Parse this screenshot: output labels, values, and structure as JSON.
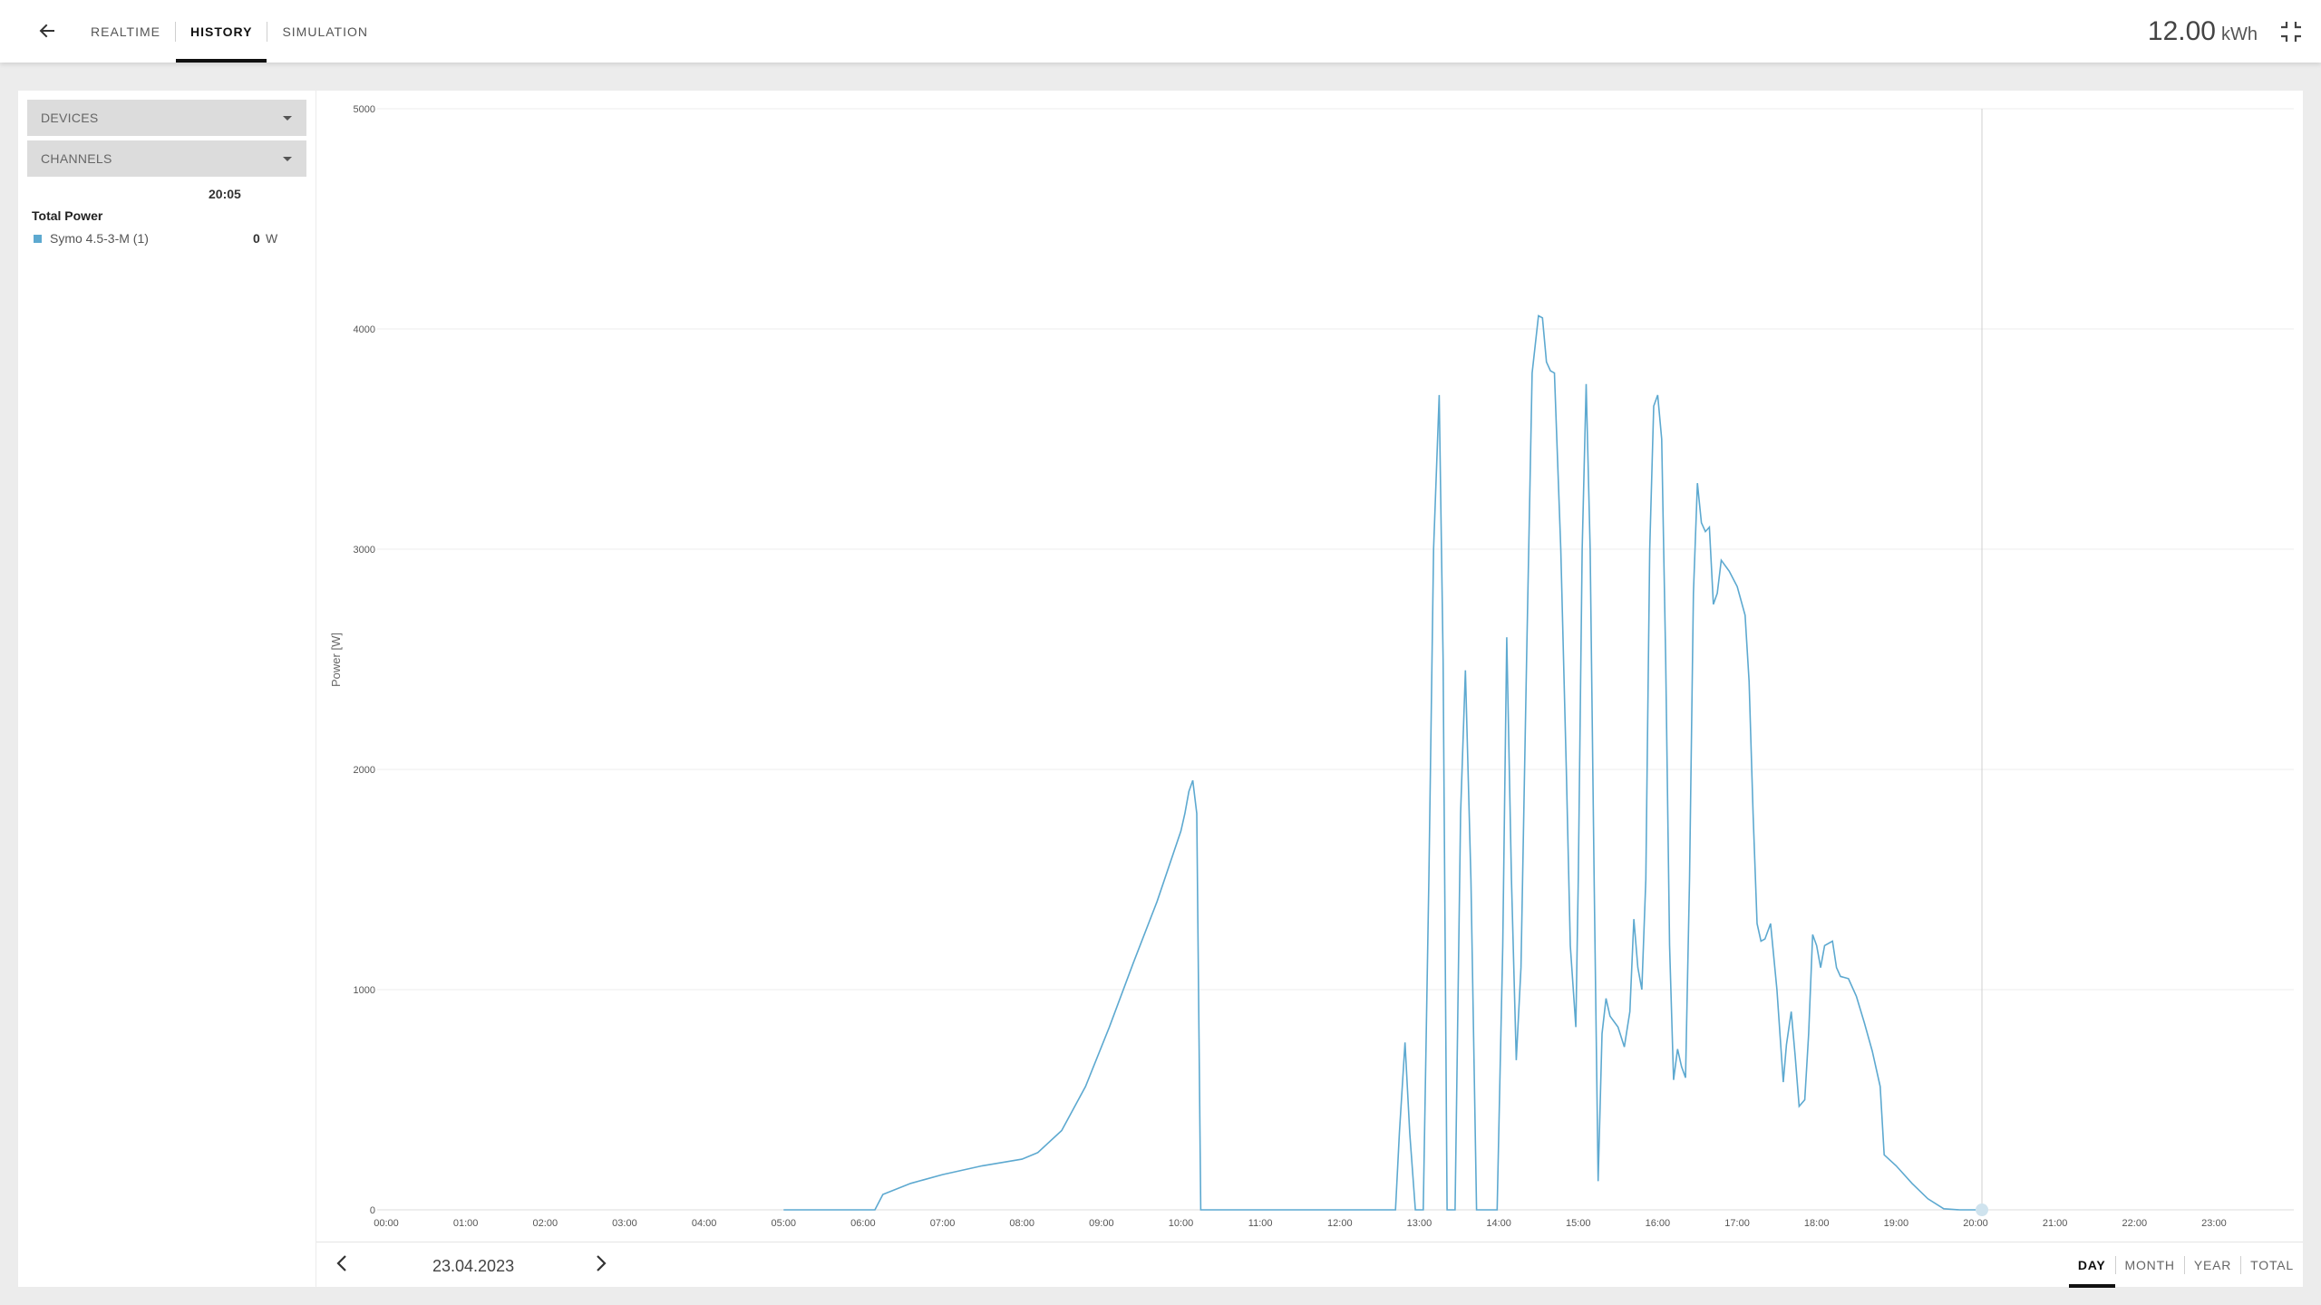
{
  "header": {
    "tabs": [
      {
        "label": "REALTIME",
        "active": false
      },
      {
        "label": "HISTORY",
        "active": true
      },
      {
        "label": "SIMULATION",
        "active": false
      }
    ],
    "energy_value": "12.00",
    "energy_unit": "kWh",
    "icons": {
      "back": "arrow-left-icon",
      "collapse": "exit-fullscreen-icon"
    }
  },
  "sidebar": {
    "devices_label": "DEVICES",
    "channels_label": "CHANNELS",
    "legend_time": "20:05",
    "legend_title": "Total Power",
    "legend_items": [
      {
        "name": "Symo 4.5-3-M (1)",
        "value": "0",
        "unit": "W",
        "color": "#5da9d0"
      }
    ]
  },
  "footer": {
    "date": "23.04.2023",
    "range_tabs": [
      {
        "label": "DAY",
        "active": true
      },
      {
        "label": "MONTH",
        "active": false
      },
      {
        "label": "YEAR",
        "active": false
      },
      {
        "label": "TOTAL",
        "active": false
      }
    ]
  },
  "chart_data": {
    "type": "line",
    "ylabel": "Power [W]",
    "xlabel": "",
    "ylim": [
      0,
      5000
    ],
    "y_ticks": [
      0,
      1000,
      2000,
      3000,
      4000,
      5000
    ],
    "x_tick_labels": [
      "00:00",
      "01:00",
      "02:00",
      "03:00",
      "04:00",
      "05:00",
      "06:00",
      "07:00",
      "08:00",
      "09:00",
      "10:00",
      "11:00",
      "12:00",
      "13:00",
      "14:00",
      "15:00",
      "16:00",
      "17:00",
      "18:00",
      "19:00",
      "20:00",
      "21:00",
      "22:00",
      "23:00"
    ],
    "x_unit": "hours",
    "cursor_x": 20.08,
    "grid": true,
    "series": [
      {
        "name": "Symo 4.5-3-M (1)",
        "color": "#5da9d0",
        "points": [
          [
            5.0,
            0
          ],
          [
            6.15,
            0
          ],
          [
            6.25,
            70
          ],
          [
            6.6,
            120
          ],
          [
            7.0,
            160
          ],
          [
            7.5,
            200
          ],
          [
            8.0,
            230
          ],
          [
            8.2,
            260
          ],
          [
            8.5,
            360
          ],
          [
            8.8,
            560
          ],
          [
            9.1,
            830
          ],
          [
            9.4,
            1120
          ],
          [
            9.7,
            1400
          ],
          [
            10.0,
            1720
          ],
          [
            10.05,
            1800
          ],
          [
            10.1,
            1900
          ],
          [
            10.15,
            1950
          ],
          [
            10.2,
            1800
          ],
          [
            10.25,
            0
          ],
          [
            12.7,
            0
          ],
          [
            12.75,
            350
          ],
          [
            12.82,
            760
          ],
          [
            12.88,
            350
          ],
          [
            12.95,
            0
          ],
          [
            13.05,
            0
          ],
          [
            13.12,
            1500
          ],
          [
            13.18,
            3000
          ],
          [
            13.25,
            3700
          ],
          [
            13.3,
            2500
          ],
          [
            13.35,
            0
          ],
          [
            13.45,
            0
          ],
          [
            13.52,
            1800
          ],
          [
            13.58,
            2450
          ],
          [
            13.65,
            1500
          ],
          [
            13.72,
            0
          ],
          [
            13.98,
            0
          ],
          [
            14.05,
            1200
          ],
          [
            14.1,
            2600
          ],
          [
            14.16,
            1500
          ],
          [
            14.22,
            680
          ],
          [
            14.28,
            1100
          ],
          [
            14.35,
            2500
          ],
          [
            14.42,
            3800
          ],
          [
            14.5,
            4060
          ],
          [
            14.55,
            4050
          ],
          [
            14.6,
            3850
          ],
          [
            14.65,
            3810
          ],
          [
            14.7,
            3800
          ],
          [
            14.78,
            3000
          ],
          [
            14.85,
            2000
          ],
          [
            14.9,
            1200
          ],
          [
            14.97,
            830
          ],
          [
            15.0,
            1500
          ],
          [
            15.05,
            3000
          ],
          [
            15.1,
            3750
          ],
          [
            15.15,
            3000
          ],
          [
            15.2,
            1500
          ],
          [
            15.25,
            130
          ],
          [
            15.3,
            800
          ],
          [
            15.35,
            960
          ],
          [
            15.4,
            880
          ],
          [
            15.5,
            830
          ],
          [
            15.58,
            740
          ],
          [
            15.65,
            900
          ],
          [
            15.7,
            1320
          ],
          [
            15.75,
            1100
          ],
          [
            15.8,
            1000
          ],
          [
            15.85,
            1500
          ],
          [
            15.9,
            3000
          ],
          [
            15.95,
            3650
          ],
          [
            16.0,
            3700
          ],
          [
            16.05,
            3500
          ],
          [
            16.1,
            2500
          ],
          [
            16.15,
            1200
          ],
          [
            16.2,
            590
          ],
          [
            16.25,
            730
          ],
          [
            16.3,
            650
          ],
          [
            16.35,
            600
          ],
          [
            16.4,
            1500
          ],
          [
            16.45,
            2800
          ],
          [
            16.5,
            3300
          ],
          [
            16.55,
            3120
          ],
          [
            16.6,
            3080
          ],
          [
            16.65,
            3100
          ],
          [
            16.7,
            2750
          ],
          [
            16.75,
            2800
          ],
          [
            16.8,
            2950
          ],
          [
            16.9,
            2900
          ],
          [
            17.0,
            2830
          ],
          [
            17.1,
            2700
          ],
          [
            17.15,
            2400
          ],
          [
            17.2,
            1800
          ],
          [
            17.25,
            1300
          ],
          [
            17.3,
            1220
          ],
          [
            17.35,
            1230
          ],
          [
            17.42,
            1300
          ],
          [
            17.5,
            1000
          ],
          [
            17.58,
            580
          ],
          [
            17.62,
            750
          ],
          [
            17.68,
            900
          ],
          [
            17.73,
            700
          ],
          [
            17.78,
            470
          ],
          [
            17.85,
            500
          ],
          [
            17.9,
            800
          ],
          [
            17.95,
            1250
          ],
          [
            18.0,
            1200
          ],
          [
            18.05,
            1100
          ],
          [
            18.1,
            1200
          ],
          [
            18.2,
            1220
          ],
          [
            18.25,
            1100
          ],
          [
            18.3,
            1060
          ],
          [
            18.4,
            1050
          ],
          [
            18.5,
            970
          ],
          [
            18.6,
            850
          ],
          [
            18.7,
            720
          ],
          [
            18.8,
            560
          ],
          [
            18.85,
            250
          ],
          [
            19.0,
            200
          ],
          [
            19.2,
            120
          ],
          [
            19.4,
            50
          ],
          [
            19.6,
            5
          ],
          [
            19.8,
            0
          ],
          [
            20.1,
            0
          ]
        ]
      }
    ]
  }
}
